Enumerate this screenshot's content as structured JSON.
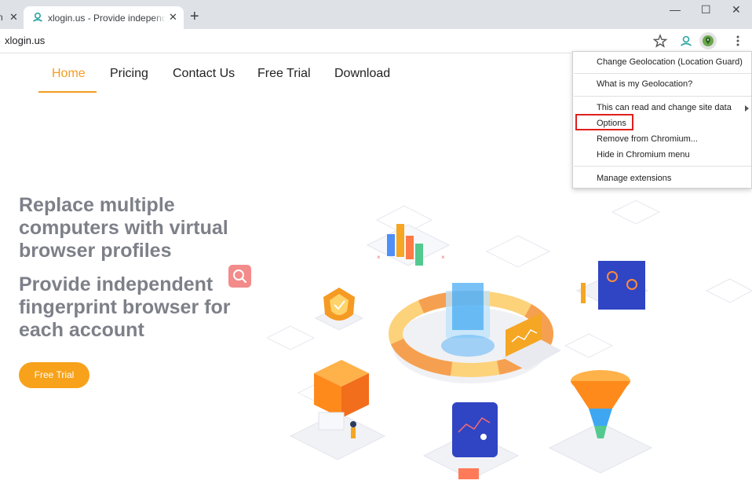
{
  "browser": {
    "prev_tab": {
      "fragment": "n",
      "close": "✕"
    },
    "active_tab": {
      "title": "xlogin.us - Provide independent fingerprint browser",
      "close": "✕"
    },
    "new_tab": "+",
    "window_controls": {
      "minimize": "—",
      "maximize": "☐",
      "close": "✕"
    },
    "address": "xlogin.us",
    "toolbar_icons": [
      "star-icon",
      "location-guard-icon",
      "geo-pin-extension-icon",
      "more-vert-icon"
    ]
  },
  "nav": {
    "items": [
      {
        "label": "Home",
        "active": true
      },
      {
        "label": "Pricing",
        "active": false
      },
      {
        "label": "Contact Us",
        "active": false
      },
      {
        "label": "Free Trial",
        "active": false
      },
      {
        "label": "Download",
        "active": false
      }
    ]
  },
  "hero": {
    "headline_1": "Replace multiple computers with virtual browser profiles",
    "headline_2": "Provide independent fingerprint browser for each account",
    "cta": "Free Trial"
  },
  "context_menu": {
    "items": [
      {
        "label": "Change Geolocation (Location Guard)",
        "separator_after": true
      },
      {
        "label": "What is my Geolocation?",
        "separator_after": true
      },
      {
        "label": "This can read and change site data",
        "submenu": true
      },
      {
        "label": "Options",
        "highlighted": true
      },
      {
        "label": "Remove from Chromium..."
      },
      {
        "label": "Hide in Chromium menu",
        "separator_after": true
      },
      {
        "label": "Manage extensions"
      }
    ]
  },
  "colors": {
    "accent": "#f39c1f",
    "cta": "#f7a21a",
    "headline": "#7d8088",
    "highlight": "#e0201b",
    "tabstrip": "#dee1e6"
  }
}
